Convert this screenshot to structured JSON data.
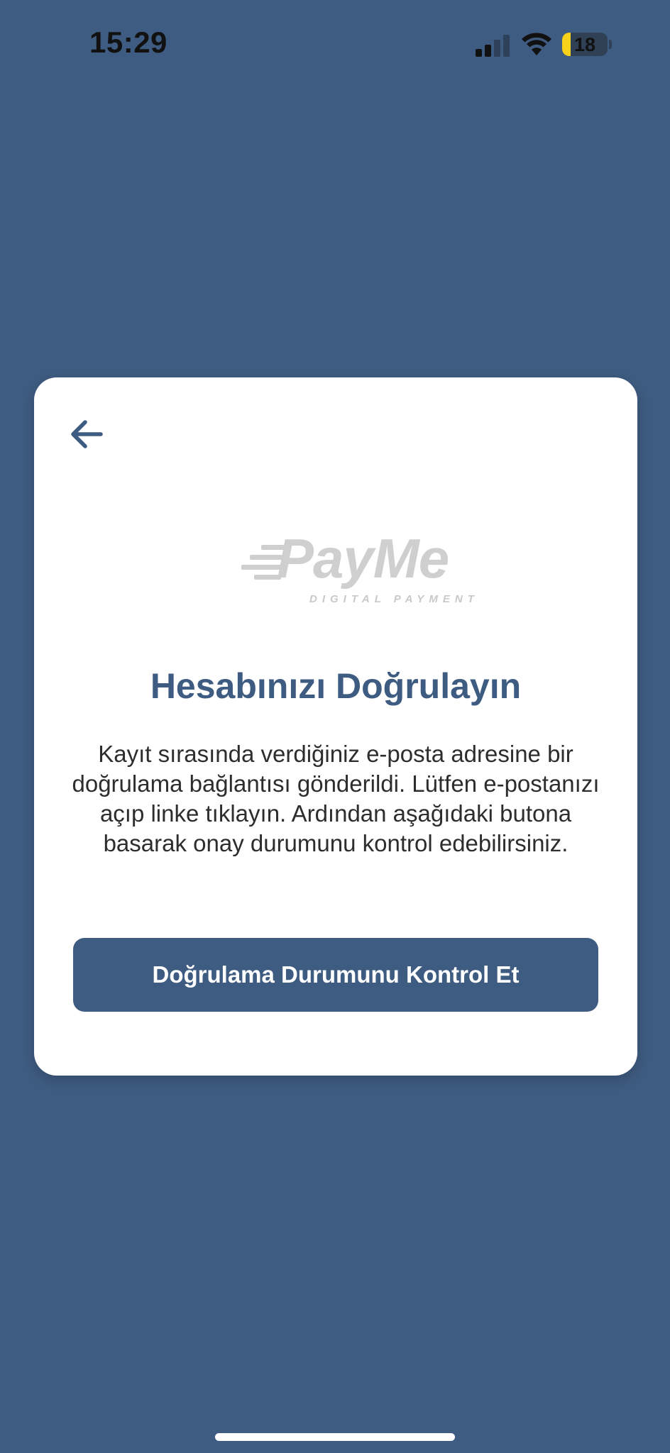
{
  "status_bar": {
    "time": "15:29",
    "battery_level": "18",
    "battery_color": "#f7d11a"
  },
  "card": {
    "back_icon": "arrow-left-icon",
    "logo": {
      "wordmark": "PayMe",
      "tagline": "DIGITAL PAYMENT"
    },
    "title": "Hesabınızı Doğrulayın",
    "description": "Kayıt sırasında verdiğiniz e-posta adresine bir doğrulama bağlantısı gönderildi. Lütfen e-postanızı açıp linke tıklayın. Ardından aşağıdaki butona basarak onay durumunu kontrol edebilirsiniz.",
    "button_label": "Doğrulama Durumunu Kontrol Et"
  },
  "colors": {
    "background": "#3e5b81",
    "card": "#ffffff",
    "accent": "#3e5b81",
    "logo": "#cfcfcf"
  }
}
